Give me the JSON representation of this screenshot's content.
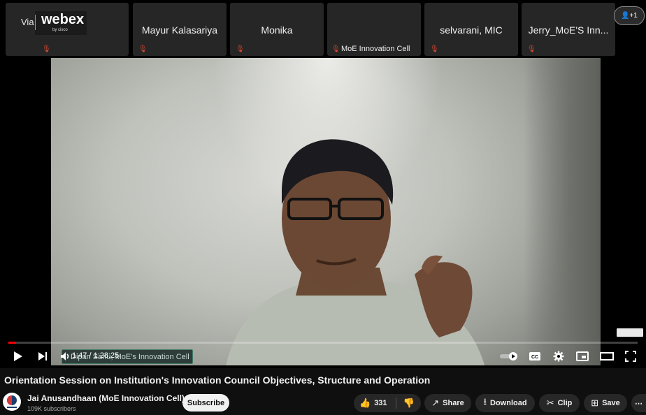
{
  "webex": {
    "via": "Via",
    "logo": "webex",
    "logo_sub": "by cisco",
    "participants": [
      {
        "name": "a"
      },
      {
        "name": "Mayur Kalasariya"
      },
      {
        "name": "Monika"
      },
      {
        "name": "MoE Innovation Cell"
      },
      {
        "name": "selvarani, MIC"
      },
      {
        "name": "Jerry_MoE'S Inn..."
      }
    ],
    "people_count": "+1"
  },
  "player": {
    "camera_label": "Dipan Sahu, MoE's Innovation Cell",
    "time": "1:47 / 1:28:25",
    "progress_fraction": 0.012
  },
  "video": {
    "title": "Orientation Session on Institution's Innovation Council Objectives, Structure and Operation"
  },
  "channel": {
    "name": "Jai Anusandhaan (MoE Innovation Cell)",
    "subscribers": "109K subscribers",
    "subscribe_label": "Subscribe"
  },
  "actions": {
    "likes": "331",
    "share": "Share",
    "download": "Download",
    "clip": "Clip",
    "save": "Save",
    "more": "⋯"
  },
  "colors": {
    "accent": "#ff0000",
    "mic_muted": "#e0492f",
    "background": "#0f0f0f"
  }
}
